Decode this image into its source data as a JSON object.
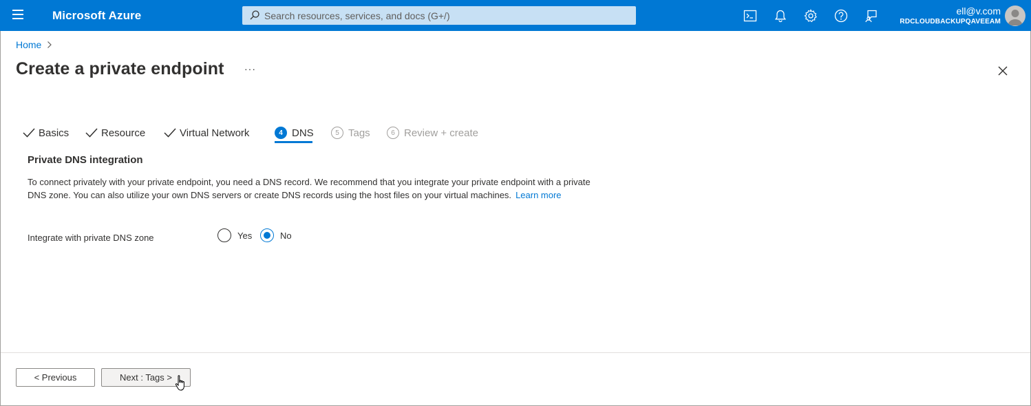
{
  "topbar": {
    "brand": "Microsoft Azure",
    "search_placeholder": "Search resources, services, and docs (G+/)",
    "icons": [
      "menu-icon",
      "cloud-shell-icon",
      "notifications-icon",
      "settings-icon",
      "help-icon",
      "feedback-icon"
    ],
    "user": "ell@v.com",
    "tenant": "RDCLOUDBACKUPQAVEEAM"
  },
  "breadcrumb": {
    "home": "Home"
  },
  "page": {
    "title": "Create a private endpoint",
    "more": "···"
  },
  "tabs": [
    {
      "label": "Basics",
      "state": "done"
    },
    {
      "label": "Resource",
      "state": "done"
    },
    {
      "label": "Virtual Network",
      "state": "done"
    },
    {
      "number": "4",
      "label": "DNS",
      "state": "active"
    },
    {
      "number": "5",
      "label": "Tags",
      "state": "pending"
    },
    {
      "number": "6",
      "label": "Review + create",
      "state": "pending"
    }
  ],
  "content": {
    "section_title": "Private DNS integration",
    "description": "To connect privately with your private endpoint, you need a DNS record. We recommend that you integrate your private endpoint with a private DNS zone. You can also utilize your own DNS servers or create DNS records using the host files on your virtual machines.",
    "learn_more": "Learn more",
    "field_label": "Integrate with private DNS zone",
    "options": [
      {
        "label": "Yes",
        "selected": false
      },
      {
        "label": "No",
        "selected": true
      }
    ]
  },
  "footer": {
    "previous_label": "< Previous",
    "next_label": "Next : Tags >"
  },
  "colors": {
    "accent": "#0078d4",
    "search_bg": "#c7e0f4",
    "text": "#323130",
    "disabled": "#a19f9d"
  }
}
